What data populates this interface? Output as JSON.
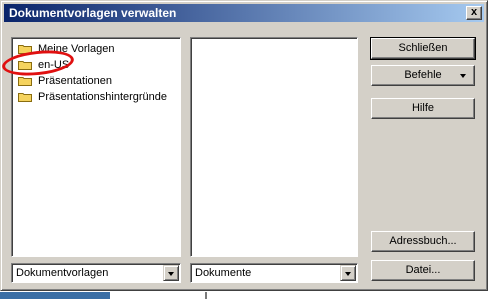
{
  "dialog": {
    "title": "Dokumentvorlagen verwalten",
    "close_glyph": "x"
  },
  "left_tree": {
    "items": [
      {
        "label": "Meine Vorlagen"
      },
      {
        "label": "en-US"
      },
      {
        "label": "Präsentationen"
      },
      {
        "label": "Präsentationshintergründe"
      }
    ]
  },
  "left_combo": {
    "value": "Dokumentvorlagen"
  },
  "mid_combo": {
    "value": "Dokumente"
  },
  "buttons": {
    "close": "Schließen",
    "commands": "Befehle",
    "help": "Hilfe",
    "address_book": "Adressbuch...",
    "file": "Datei..."
  },
  "colors": {
    "title_gradient_start": "#0a246a",
    "title_gradient_end": "#a6caf0",
    "dialog_face": "#d4d0c8",
    "annotation": "#e01010",
    "folder": "#f5d35e"
  },
  "icons": {
    "folder": "folder-icon",
    "close": "close-icon",
    "dropdown": "chevron-down-icon"
  }
}
